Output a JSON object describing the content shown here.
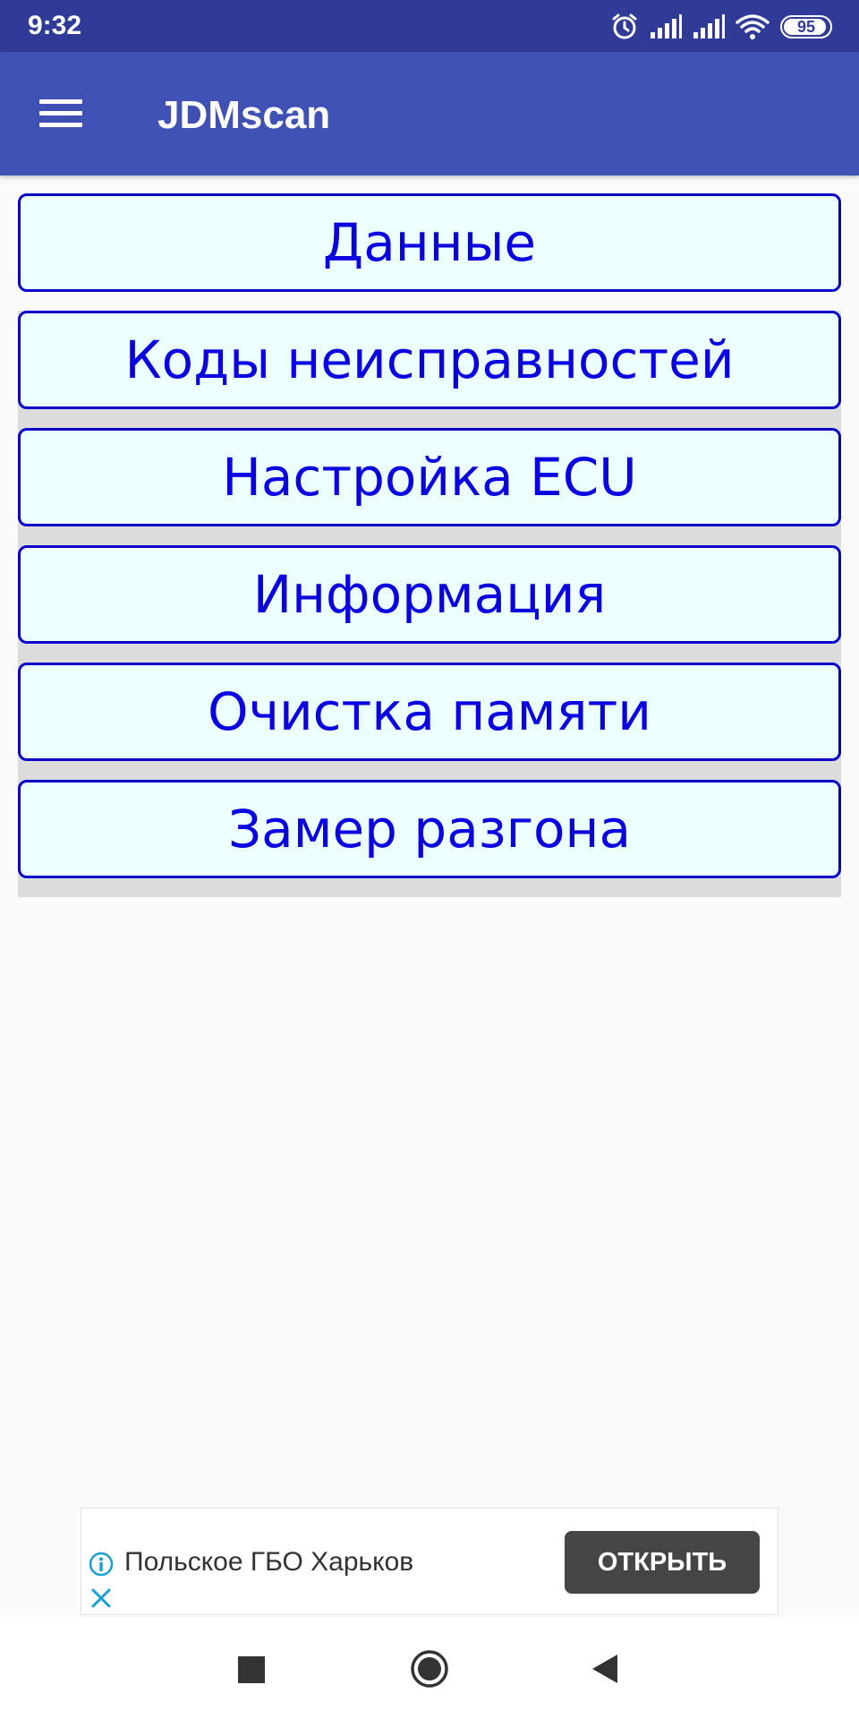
{
  "status_bar": {
    "time": "9:32",
    "battery_level": "95",
    "icons": [
      "alarm-icon",
      "signal-icon",
      "signal-icon",
      "wifi-icon",
      "battery-icon"
    ]
  },
  "app_bar": {
    "title": "JDMscan",
    "menu_icon": "hamburger-menu-icon"
  },
  "menu": {
    "items": [
      {
        "label": "Данные"
      },
      {
        "label": "Коды неисправностей"
      },
      {
        "label": "Настройка ECU"
      },
      {
        "label": "Информация"
      },
      {
        "label": "Очистка памяти"
      },
      {
        "label": "Замер разгона"
      }
    ]
  },
  "ad": {
    "text": "Польское ГБО Харьков",
    "button_label": "ОТКРЫТЬ",
    "info_icon": "info-icon",
    "close_icon": "close-icon"
  },
  "nav_bar": {
    "icons": [
      "recent-apps-icon",
      "home-icon",
      "back-icon"
    ]
  },
  "colors": {
    "status_bar": "#2f3b97",
    "app_bar": "#3f51b5",
    "button_border": "#0b00c8",
    "button_text": "#0a00e0",
    "button_bg": "#ecfffd",
    "separator": "#dcdcdc",
    "ad_button": "#454545",
    "ad_icon": "#18a0d8"
  }
}
